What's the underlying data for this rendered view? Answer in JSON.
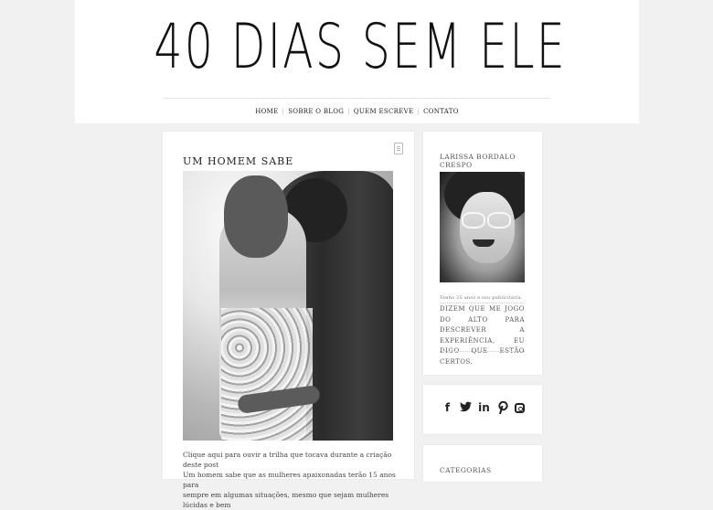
{
  "header": {
    "blog_title": "40 DIAS SEM ELE"
  },
  "nav": {
    "items": [
      "HOME",
      "SOBRE O BLOG",
      "QUEM ESCREVE",
      "CONTATO"
    ]
  },
  "post": {
    "title": "UM HOMEM SABE",
    "text_line1": "Clique aqui para ouvir a trilha que tocava durante a criação deste post",
    "text_line2": "Um homem sabe que as mulheres apaixonadas terão 15 anos para",
    "text_line3": "sempre em algumas situações, mesmo que sejam mulheres lúcidas e bem"
  },
  "sidebar": {
    "profile": {
      "name": "LARISSA BORDALO CRESPO",
      "sub": "Tenho 25 anos e sou publicitária.",
      "quote": "DIZEM QUE ME JOGO DO ALTO PARA DESCREVER A EXPERIÊNCIA, EU DIGO QUE ESTÃO CERTOS."
    },
    "social": {
      "icons": [
        "facebook-icon",
        "twitter-icon",
        "linkedin-icon",
        "pinterest-icon",
        "instagram-icon"
      ]
    },
    "categories": {
      "title": "CATEGORIAS"
    }
  }
}
